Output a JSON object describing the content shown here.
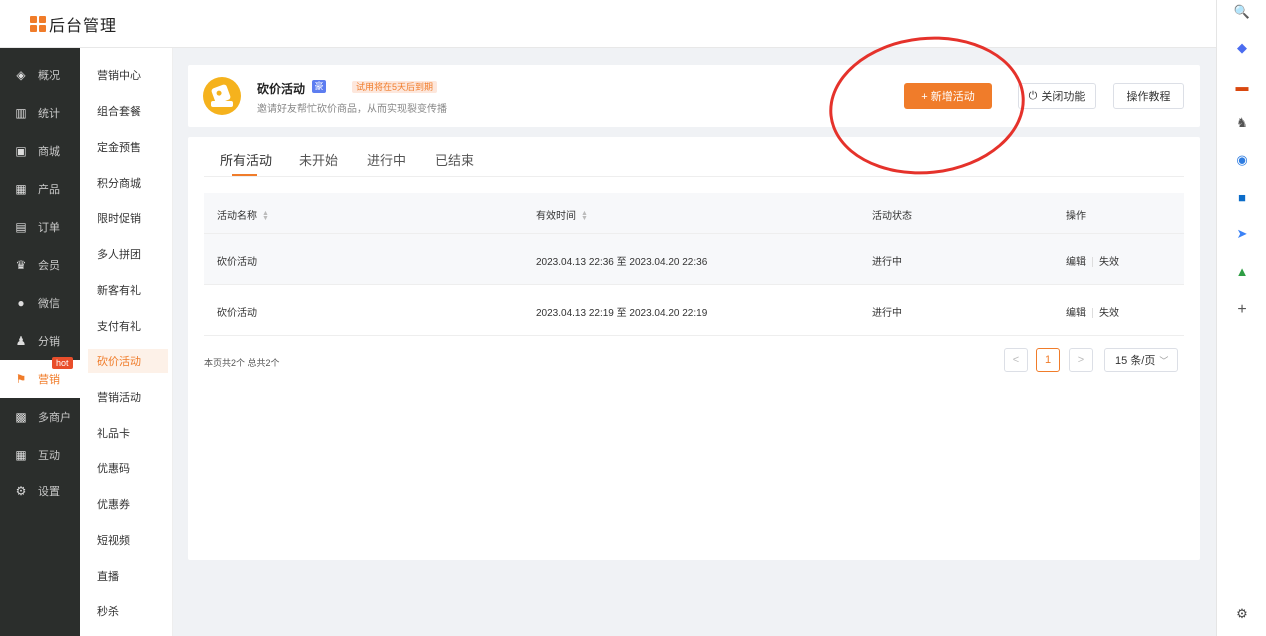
{
  "app": {
    "title": "后台管理"
  },
  "primary_nav": [
    {
      "icon": "layers-icon",
      "label": "概况"
    },
    {
      "icon": "chart-icon",
      "label": "统计"
    },
    {
      "icon": "shop-icon",
      "label": "商城"
    },
    {
      "icon": "grid-icon",
      "label": "产品"
    },
    {
      "icon": "clipboard-icon",
      "label": "订单"
    },
    {
      "icon": "crown-icon",
      "label": "会员"
    },
    {
      "icon": "wechat-icon",
      "label": "微信"
    },
    {
      "icon": "users-icon",
      "label": "分销"
    },
    {
      "icon": "flag-icon",
      "label": "营销",
      "badge": "hot",
      "active": true
    },
    {
      "icon": "merchant-icon",
      "label": "多商户"
    },
    {
      "icon": "apps-icon",
      "label": "互动"
    },
    {
      "icon": "gear-icon",
      "label": "设置"
    }
  ],
  "secondary_nav": [
    {
      "label": "营销中心"
    },
    {
      "label": "组合套餐"
    },
    {
      "label": "定金预售"
    },
    {
      "label": "积分商城"
    },
    {
      "label": "限时促销"
    },
    {
      "label": "多人拼团"
    },
    {
      "label": "新客有礼"
    },
    {
      "label": "支付有礼"
    },
    {
      "label": "砍价活动",
      "active": true
    },
    {
      "label": "营销活动"
    },
    {
      "label": "礼品卡"
    },
    {
      "label": "优惠码"
    },
    {
      "label": "优惠券"
    },
    {
      "label": "短视频"
    },
    {
      "label": "直播"
    },
    {
      "label": "秒杀"
    }
  ],
  "header": {
    "title": "砍价活动",
    "badge": "豪",
    "trial_notice": "试用将在5天后到期",
    "description": "邀请好友帮忙砍价商品，从而实现裂变传播",
    "add_button": "+ 新增活动",
    "close_button": "关闭功能",
    "tutorial_button": "操作教程"
  },
  "tabs": [
    {
      "label": "所有活动",
      "active": true
    },
    {
      "label": "未开始"
    },
    {
      "label": "进行中"
    },
    {
      "label": "已结束"
    }
  ],
  "table": {
    "columns": [
      "活动名称",
      "有效时间",
      "活动状态",
      "操作"
    ],
    "rows": [
      {
        "name": "砍价活动",
        "time": "2023.04.13 22:36 至 2023.04.20 22:36",
        "status": "进行中",
        "edit": "编辑",
        "disable": "失效"
      },
      {
        "name": "砍价活动",
        "time": "2023.04.13 22:19 至 2023.04.20 22:19",
        "status": "进行中",
        "edit": "编辑",
        "disable": "失效"
      }
    ]
  },
  "pagination": {
    "info": "本页共2个 总共2个",
    "prev": "<",
    "current": "1",
    "next": ">",
    "page_size": "15 条/页"
  },
  "right_toolbar": [
    "search-icon",
    "tag-icon",
    "toolbox-icon",
    "chess-icon",
    "office-icon",
    "outlook-icon",
    "send-icon",
    "tree-icon",
    "plus-icon",
    "settings-icon"
  ],
  "colors": {
    "accent": "#f07c2a",
    "sidebar_dark": "#2b2e2c",
    "hot_badge": "#e94e2b",
    "annotation": "#e5322b"
  }
}
